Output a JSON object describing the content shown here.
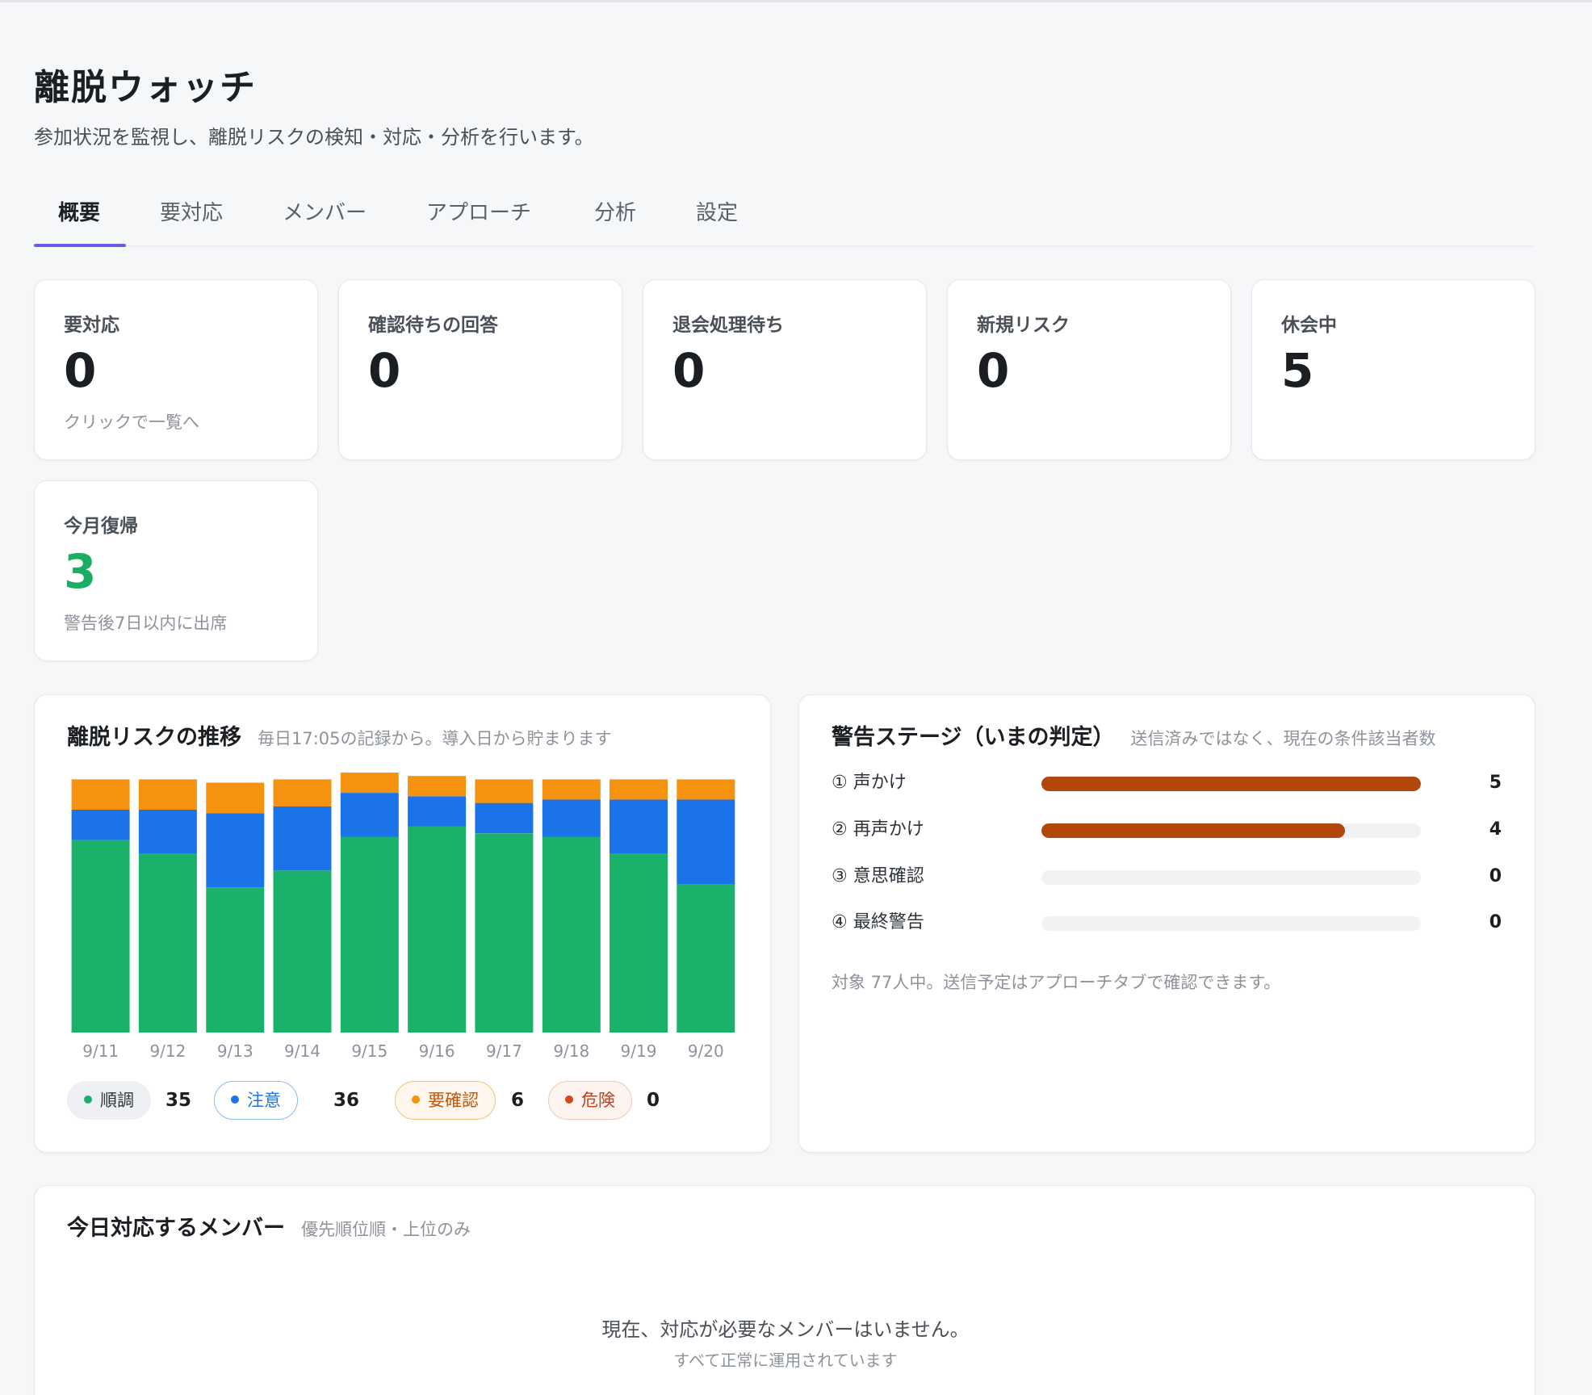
{
  "header": {
    "title": "離脱ウォッチ",
    "subtitle": "参加状況を監視し、離脱リスクの検知・対応・分析を行います。"
  },
  "tabs": [
    {
      "label": "概要",
      "active": true
    },
    {
      "label": "要対応"
    },
    {
      "label": "メンバー"
    },
    {
      "label": "アプローチ"
    },
    {
      "label": "分析"
    },
    {
      "label": "設定"
    }
  ],
  "stats": [
    {
      "label": "要対応",
      "value": "0",
      "note": "クリックで一覧へ"
    },
    {
      "label": "確認待ちの回答",
      "value": "0",
      "note": ""
    },
    {
      "label": "退会処理待ち",
      "value": "0",
      "note": ""
    },
    {
      "label": "新規リスク",
      "value": "0",
      "note": ""
    },
    {
      "label": "休会中",
      "value": "5",
      "note": ""
    },
    {
      "label": "今月復帰",
      "value": "3",
      "note": "警告後7日以内に出席"
    }
  ],
  "trend": {
    "title": "離脱リスクの推移",
    "subtitle": "毎日17:05の記録から。導入日から貯まります",
    "legend": [
      {
        "label": "順調",
        "count": "35",
        "color": "#1ab26a"
      },
      {
        "label": "注意",
        "count": "36",
        "color": "#1a73e8"
      },
      {
        "label": "要確認",
        "count": "6",
        "color": "#f5920f"
      },
      {
        "label": "危険",
        "count": "0",
        "color": "#d1481a"
      }
    ]
  },
  "chart_data": {
    "type": "bar",
    "stacked": true,
    "categories": [
      "9/11",
      "9/12",
      "9/13",
      "9/14",
      "9/15",
      "9/16",
      "9/17",
      "9/18",
      "9/19",
      "9/20"
    ],
    "series": [
      {
        "name": "順調",
        "color": "#1ab26a",
        "values": [
          57,
          53,
          43,
          48,
          58,
          61,
          59,
          58,
          53,
          44
        ]
      },
      {
        "name": "注意",
        "color": "#1a73e8",
        "values": [
          9,
          13,
          22,
          19,
          13,
          9,
          9,
          11,
          16,
          25
        ]
      },
      {
        "name": "要確認",
        "color": "#f5920f",
        "values": [
          9,
          9,
          9,
          8,
          6,
          6,
          7,
          6,
          6,
          6
        ]
      },
      {
        "name": "危険",
        "color": "#d1481a",
        "values": [
          0,
          0,
          0,
          0,
          0,
          0,
          0,
          0,
          0,
          0
        ]
      }
    ],
    "ylim": [
      0,
      77
    ]
  },
  "stages": {
    "title": "警告ステージ（いまの判定）",
    "subtitle": "送信済みではなく、現在の条件該当者数",
    "items": [
      {
        "label": "① 声かけ",
        "count": "5",
        "fraction": 1.0
      },
      {
        "label": "② 再声かけ",
        "count": "4",
        "fraction": 0.8
      },
      {
        "label": "③ 意思確認",
        "count": "0",
        "fraction": 0
      },
      {
        "label": "④ 最終警告",
        "count": "0",
        "fraction": 0
      }
    ],
    "note": "対象 77人中。送信予定はアプローチタブで確認できます。"
  },
  "today": {
    "title": "今日対応するメンバー",
    "subtitle": "優先順位順・上位のみ",
    "empty_message": "現在、対応が必要なメンバーはいません。",
    "empty_sub": "すべて正常に運用されています"
  }
}
